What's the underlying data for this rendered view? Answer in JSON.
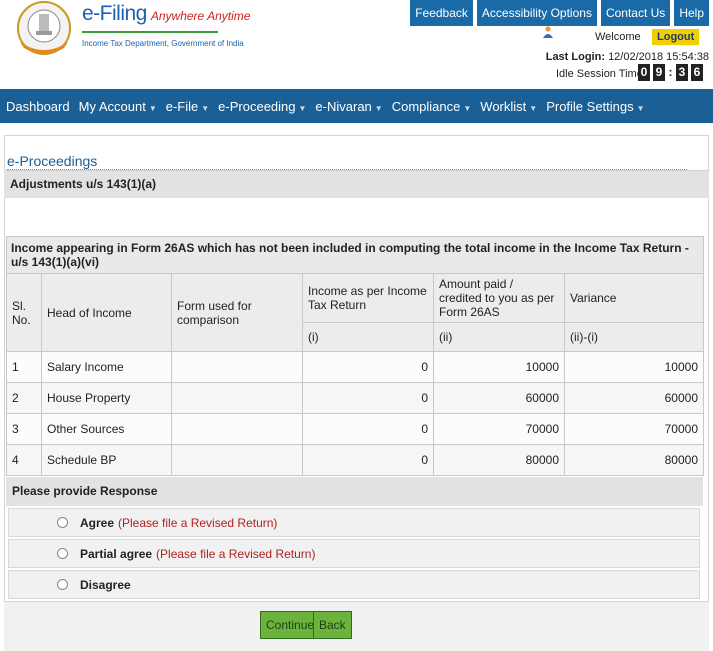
{
  "brand": {
    "title": "e-Filing",
    "tagline": "Anywhere Anytime",
    "subtitle": "Income Tax Department, Government of India"
  },
  "topnav": [
    "Feedback",
    "Accessibility Options",
    "Contact Us",
    "Help"
  ],
  "user": {
    "welcome": "Welcome",
    "logout": "Logout",
    "last_login_label": "Last Login:",
    "last_login_value": "12/02/2018 15:54:38",
    "idle_label": "Idle Session Timer",
    "timer_digits": [
      "0",
      "9",
      "3",
      "6"
    ]
  },
  "mainnav": [
    {
      "label": "Dashboard",
      "dropdown": false
    },
    {
      "label": "My Account",
      "dropdown": true
    },
    {
      "label": "e-File",
      "dropdown": true
    },
    {
      "label": "e-Proceeding",
      "dropdown": true
    },
    {
      "label": "e-Nivaran",
      "dropdown": true
    },
    {
      "label": "Compliance",
      "dropdown": true
    },
    {
      "label": "Worklist",
      "dropdown": true
    },
    {
      "label": "Profile Settings",
      "dropdown": true
    }
  ],
  "page": {
    "breadcrumb": "e-Proceedings",
    "section_title": "Adjustments u/s 143(1)(a)"
  },
  "table": {
    "caption": "Income appearing in Form 26AS which has not been included in computing the total income in the Income Tax Return - u/s 143(1)(a)(vi)",
    "headers": [
      "Sl. No.",
      "Head of Income",
      "Form used for comparison",
      "Income as per Income Tax Return",
      "Amount paid / credited to you as per Form 26AS",
      "Variance"
    ],
    "subheaders": [
      "(i)",
      "(ii)",
      "(ii)-(i)"
    ],
    "rows": [
      {
        "sl": "1",
        "head": "Salary Income",
        "form": "",
        "itr": "0",
        "f26as": "10000",
        "variance": "10000"
      },
      {
        "sl": "2",
        "head": "House Property",
        "form": "",
        "itr": "0",
        "f26as": "60000",
        "variance": "60000"
      },
      {
        "sl": "3",
        "head": "Other Sources",
        "form": "",
        "itr": "0",
        "f26as": "70000",
        "variance": "70000"
      },
      {
        "sl": "4",
        "head": "Schedule BP",
        "form": "",
        "itr": "0",
        "f26as": "80000",
        "variance": "80000"
      }
    ]
  },
  "response": {
    "title": "Please provide Response",
    "options": [
      {
        "label": "Agree",
        "hint": "(Please file a Revised Return)"
      },
      {
        "label": "Partial agree",
        "hint": "(Please file a Revised Return)"
      },
      {
        "label": "Disagree",
        "hint": ""
      }
    ]
  },
  "buttons": {
    "continue": "Continue",
    "back": "Back"
  },
  "colors": {
    "nav_blue": "#1a5f95",
    "logout_yellow": "#f0d000",
    "button_green": "#6cb33e",
    "hint_red": "#b02020"
  }
}
